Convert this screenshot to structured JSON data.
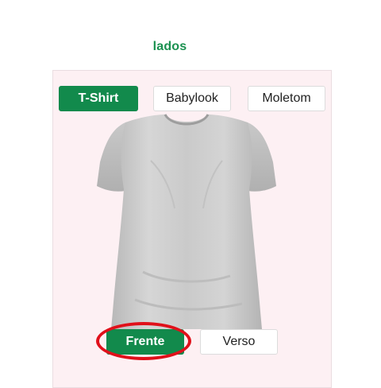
{
  "heading": "lados",
  "product_types": {
    "tshirt": "T-Shirt",
    "babylook": "Babylook",
    "moletom": "Moletom"
  },
  "sides": {
    "front": "Frente",
    "back": "Verso"
  },
  "colors": {
    "accent": "#128a4c",
    "panel_bg": "#fdf0f3",
    "highlight": "#e0101a"
  }
}
